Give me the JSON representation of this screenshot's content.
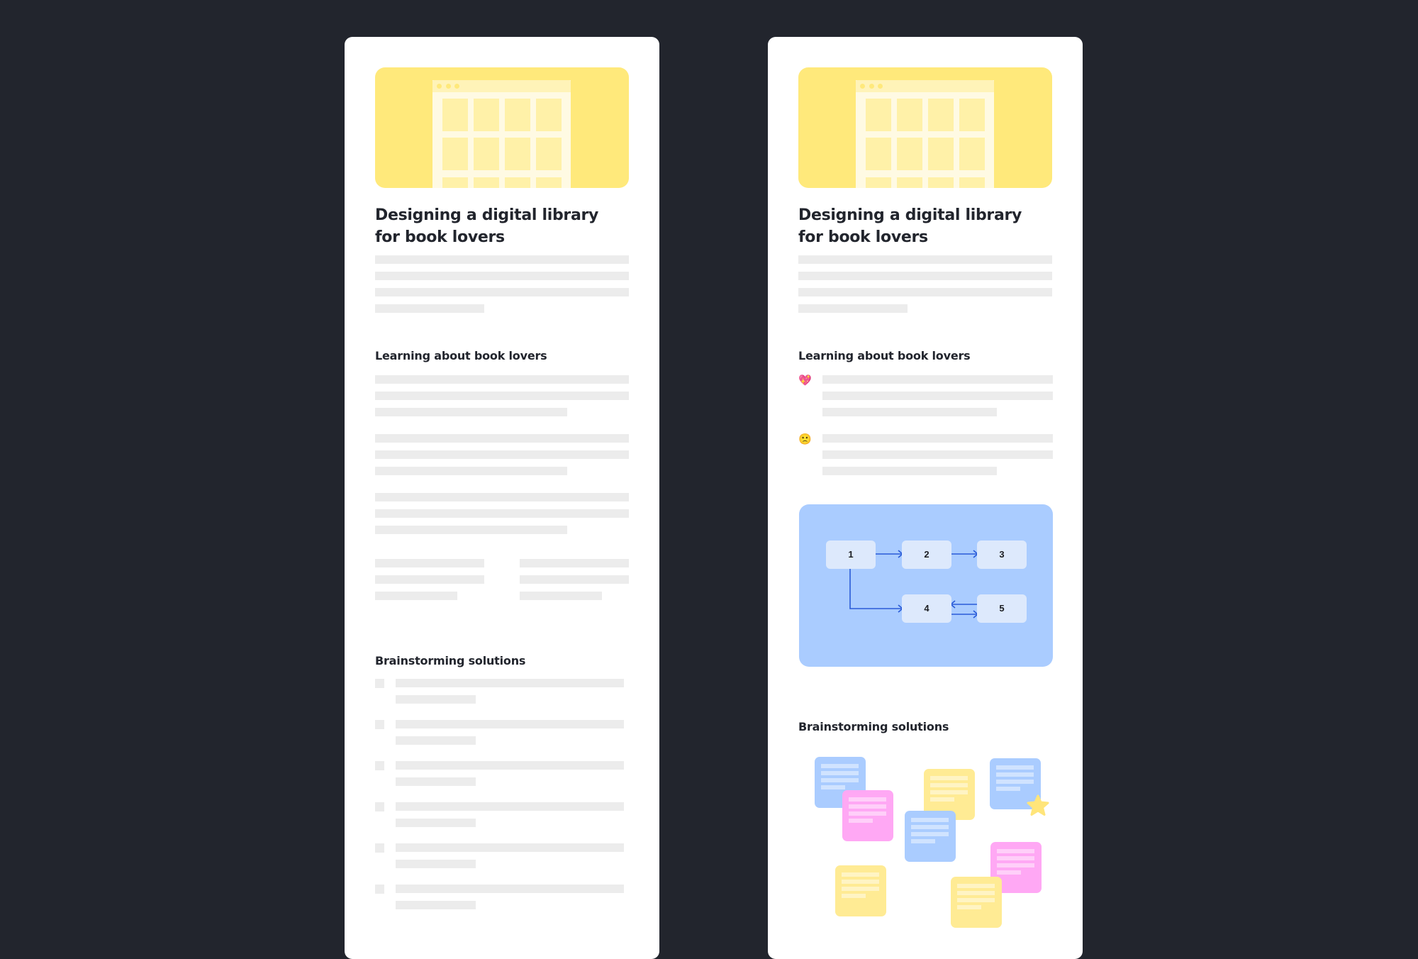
{
  "background_color": "#22252d",
  "cards": [
    {
      "id": "left",
      "title_lines": [
        "Designing a digital library",
        "for book lovers"
      ],
      "section_learning": {
        "heading": "Learning about book lovers"
      },
      "section_brainstorm": {
        "heading": "Brainstorming solutions",
        "checklist_item_count": 6
      }
    },
    {
      "id": "right",
      "title_lines": [
        "Designing a digital library",
        "for book lovers"
      ],
      "section_learning": {
        "heading": "Learning about book lovers",
        "findings": [
          {
            "icon": "sparkling-heart-icon",
            "emoji": "💖"
          },
          {
            "icon": "slightly-frowning-face-icon",
            "emoji": "🙁"
          }
        ]
      },
      "flowchart": {
        "nodes": [
          "1",
          "2",
          "3",
          "4",
          "5"
        ],
        "edges": [
          [
            "1",
            "2"
          ],
          [
            "2",
            "3"
          ],
          [
            "1",
            "4"
          ],
          [
            "5",
            "4"
          ],
          [
            "4",
            "5"
          ]
        ]
      },
      "section_brainstorm": {
        "heading": "Brainstorming solutions",
        "sticky_note_colors": [
          "blue",
          "pink",
          "yellow",
          "blue",
          "blue",
          "pink",
          "yellow",
          "yellow"
        ]
      }
    }
  ],
  "colors": {
    "hero_yellow": "#ffe97b",
    "skeleton_gray": "#ececec",
    "flow_panel": "#aaccff",
    "flow_node": "#dde9fc",
    "flow_arrow": "#2a5bd7",
    "sticky_blue": "#aaccff",
    "sticky_pink": "#ffa8f4",
    "sticky_yellow": "#ffeb94",
    "star": "#ffe57a"
  }
}
